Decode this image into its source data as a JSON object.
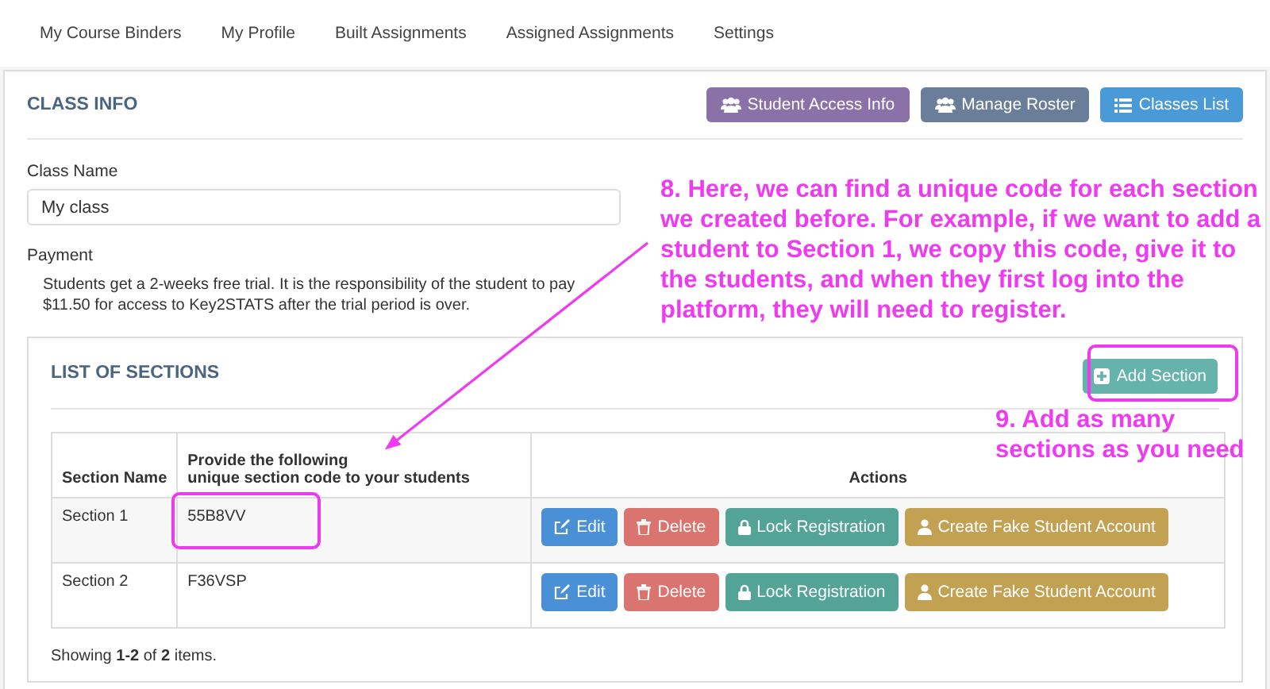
{
  "nav": [
    "My Course Binders",
    "My Profile",
    "Built Assignments",
    "Assigned Assignments",
    "Settings"
  ],
  "class_info": {
    "title": "CLASS INFO",
    "buttons": [
      {
        "label": "Student Access Info",
        "kind": "access"
      },
      {
        "label": "Manage Roster",
        "kind": "roster"
      },
      {
        "label": "Classes List",
        "kind": "list"
      }
    ],
    "class_name": {
      "label": "Class Name",
      "value": "My class"
    },
    "payment": {
      "label": "Payment",
      "text": "Students get a 2-weeks free trial. It is the responsibility of the student to pay $11.50 for access to Key2STATS after the trial period is over."
    }
  },
  "sections": {
    "title": "LIST OF SECTIONS",
    "add_button": "Add Section",
    "columns": [
      "Section Name",
      "Provide the following\nunique section code to your students",
      "Actions"
    ],
    "rows": [
      {
        "name": "Section 1",
        "code": "55B8VV",
        "actions": [
          {
            "label": "Edit",
            "kind": "edit"
          },
          {
            "label": "Delete",
            "kind": "delete"
          },
          {
            "label": "Lock Registration",
            "kind": "lock"
          },
          {
            "label": "Create Fake Student Account",
            "kind": "fake"
          }
        ]
      },
      {
        "name": "Section 2",
        "code": "F36VSP",
        "actions": [
          {
            "label": "Edit",
            "kind": "edit"
          },
          {
            "label": "Delete",
            "kind": "delete"
          },
          {
            "label": "Lock Registration",
            "kind": "lock"
          },
          {
            "label": "Create Fake Student Account",
            "kind": "fake"
          }
        ]
      }
    ],
    "summary": "Showing **1-2** of **2** items."
  },
  "annotations": [
    {
      "kind": "code",
      "text": "8. Here, we can find a unique code for each section we created before. For example, if we want to add a student to Section 1, we copy this code, give it to the students, and when they first log into the platform, they will need to register."
    },
    {
      "kind": "add",
      "text": "9. Add as many sections as you need"
    }
  ]
}
